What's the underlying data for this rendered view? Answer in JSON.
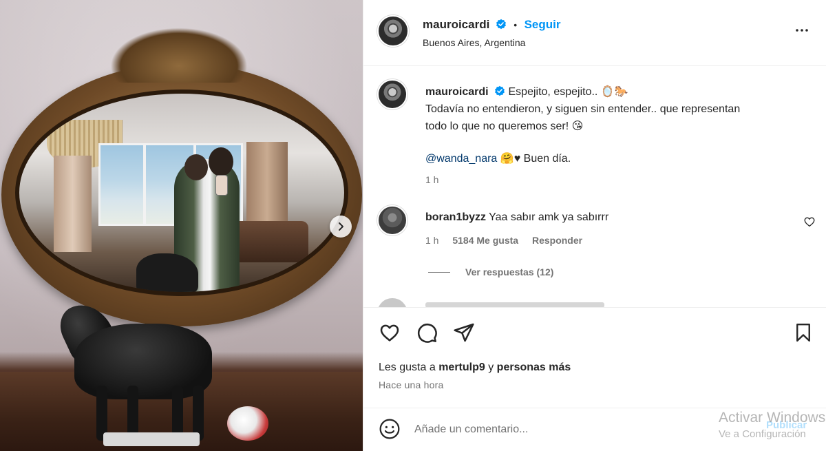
{
  "header": {
    "username": "mauroicardi",
    "separator": "•",
    "follow_label": "Seguir",
    "location": "Buenos Aires, Argentina",
    "more_icon": "more-horizontal-icon"
  },
  "caption": {
    "username": "mauroicardi",
    "first_line": "Espejito, espejito..",
    "first_line_emojis": "🪞🐎",
    "line2": "Todavía no entendieron, y siguen sin entender.. que representan",
    "line3": "todo lo que no queremos ser!",
    "line3_emoji": "😘",
    "mention": "@wanda_nara",
    "mention_emojis": "🤗♥",
    "greeting": "Buen día.",
    "time": "1 h"
  },
  "comment": {
    "username": "boran1byzz",
    "text": "Yaa sabır amk ya sabırrr",
    "time": "1 h",
    "likes": "5184 Me gusta",
    "reply_label": "Responder",
    "view_replies": "Ver respuestas (12)"
  },
  "actions": {
    "icons": [
      "heart-icon",
      "comment-icon",
      "share-icon",
      "bookmark-icon"
    ]
  },
  "likes": {
    "prefix": "Les gusta a",
    "user": "mertulp9",
    "conjunction": "y",
    "others": "personas más"
  },
  "posted": "Hace una hora",
  "add_comment": {
    "placeholder": "Añade un comentario...",
    "publish_label": "Publicar"
  },
  "watermark": {
    "line1": "Activar Windows",
    "line2": "Ve a Configuración"
  },
  "colors": {
    "accent": "#0095f6",
    "text": "#262626",
    "secondary": "#737373",
    "border": "#efefef"
  }
}
